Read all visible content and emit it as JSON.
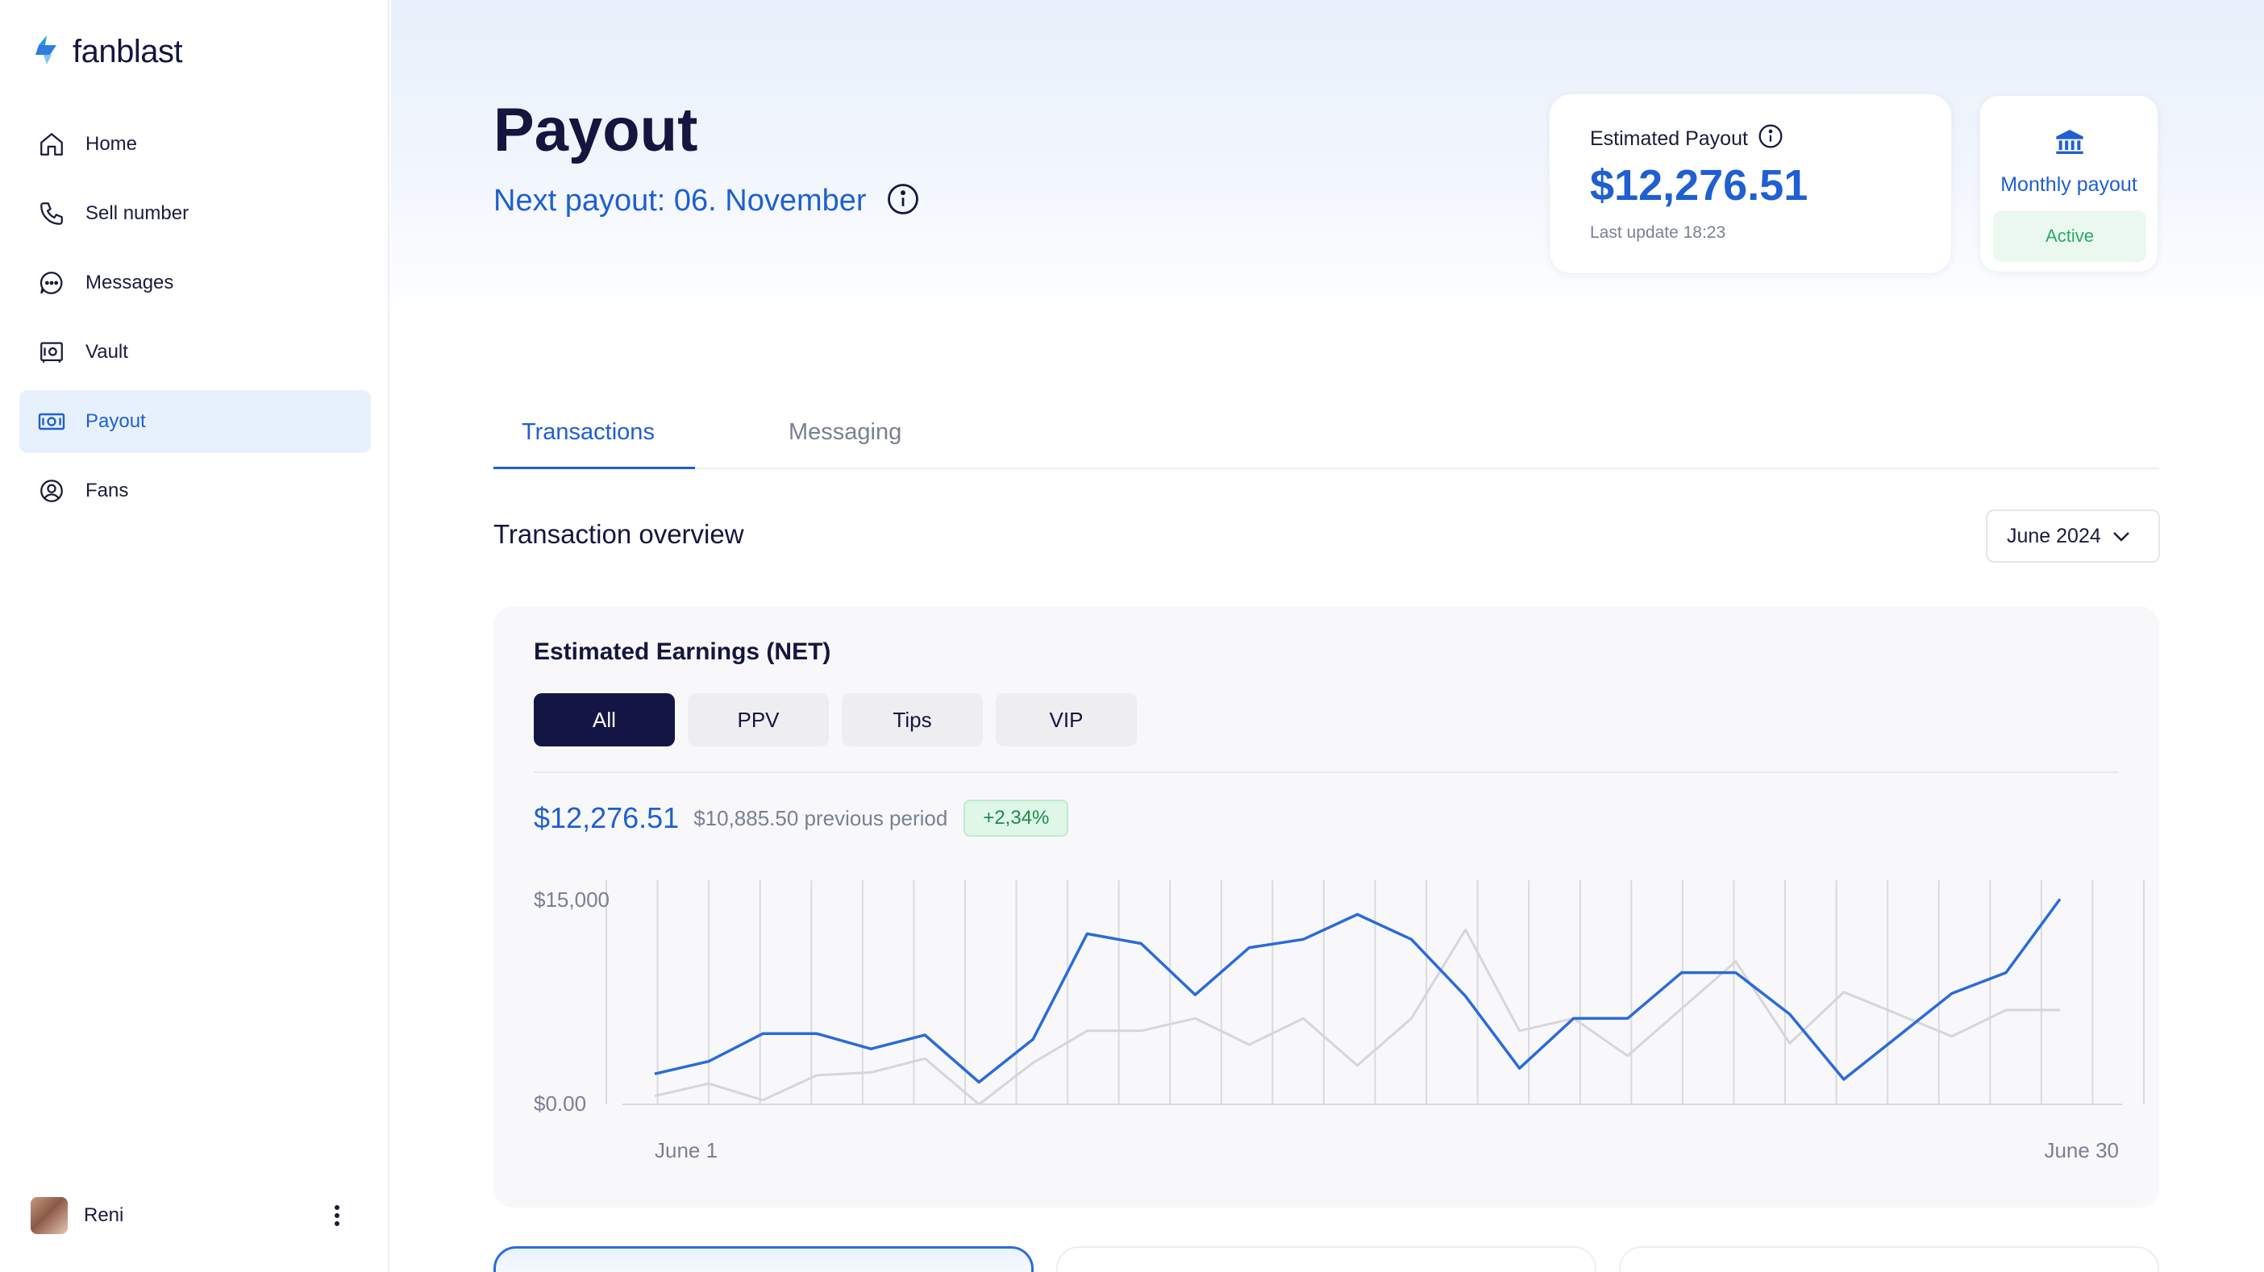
{
  "app": {
    "brand": "fanblast"
  },
  "sidebar": {
    "items": [
      {
        "label": "Home",
        "icon": "home-icon",
        "active": false
      },
      {
        "label": "Sell number",
        "icon": "phone-icon",
        "active": false
      },
      {
        "label": "Messages",
        "icon": "message-icon",
        "active": false
      },
      {
        "label": "Vault",
        "icon": "vault-icon",
        "active": false
      },
      {
        "label": "Payout",
        "icon": "cash-icon",
        "active": true
      },
      {
        "label": "Fans",
        "icon": "user-circle-icon",
        "active": false
      }
    ],
    "user": {
      "name": "Reni"
    }
  },
  "header": {
    "title": "Payout",
    "next_payout": "Next payout: 06. November"
  },
  "estimated_card": {
    "label": "Estimated Payout",
    "amount": "$12,276.51",
    "last_update": "Last update 18:23"
  },
  "monthly_card": {
    "label": "Monthly payout",
    "status": "Active"
  },
  "tabs": [
    {
      "label": "Transactions",
      "active": true
    },
    {
      "label": "Messaging",
      "active": false
    }
  ],
  "overview": {
    "title": "Transaction overview",
    "period": "June 2024"
  },
  "earnings": {
    "heading": "Estimated Earnings (NET)",
    "filters": [
      "All",
      "PPV",
      "Tips",
      "VIP"
    ],
    "active_filter": "All",
    "current": "$12,276.51",
    "previous": "$10,885.50 previous period",
    "change": "+2,34%"
  },
  "colors": {
    "accent": "#1f5fd1",
    "current_line": "#2a6bd8",
    "previous_line": "#d6d6da",
    "active_pill": "#131544",
    "positive": "#1d8a4d"
  },
  "chart_data": {
    "type": "line",
    "ylim": [
      0,
      15000
    ],
    "y_tick_labels": [
      "$15,000",
      "$0.00"
    ],
    "x_tick_labels": [
      "June 1",
      "June 30"
    ],
    "x": [
      1,
      2,
      3,
      4,
      5,
      6,
      7,
      8,
      9,
      10,
      11,
      12,
      13,
      14,
      15,
      16,
      17,
      18,
      19,
      20,
      21,
      22,
      23,
      24,
      25,
      26,
      27,
      28,
      29,
      30,
      31
    ],
    "series": [
      {
        "values": [
          2200,
          3100,
          5100,
          5100,
          4000,
          5000,
          1600,
          4700,
          12300,
          11600,
          7900,
          11300,
          11900,
          13700,
          11900,
          7800,
          2600,
          6200,
          6200,
          9500,
          9500,
          6500,
          1800,
          4900,
          8000,
          9500,
          14800
        ]
      },
      {
        "values": [
          600,
          1500,
          300,
          2100,
          2300,
          3300,
          0,
          3000,
          5300,
          5300,
          6200,
          4300,
          6200,
          2800,
          6200,
          12600,
          5300,
          6200,
          3500,
          6900,
          10300,
          4400,
          8100,
          6500,
          4900,
          6800,
          6800
        ]
      }
    ]
  }
}
